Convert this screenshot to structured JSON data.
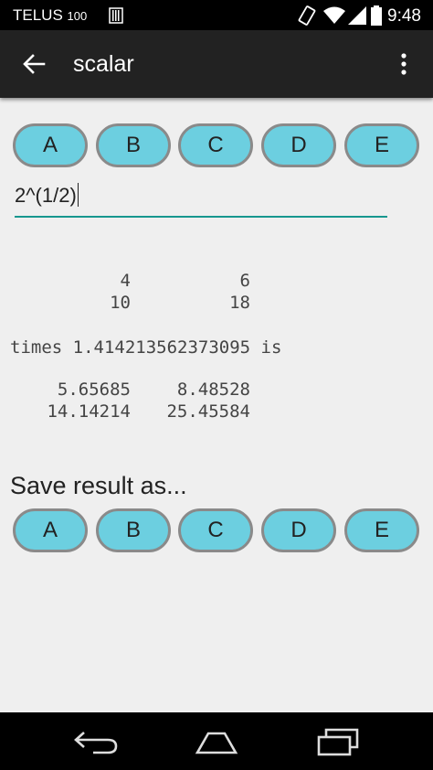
{
  "status_bar": {
    "carrier": "TELUS",
    "carrier_suffix": "100",
    "time": "9:48"
  },
  "app_bar": {
    "title": "scalar"
  },
  "matrix_buttons": [
    "A",
    "B",
    "C",
    "D",
    "E"
  ],
  "expression": {
    "value": "2^(1/2)"
  },
  "input_matrix": {
    "rows": [
      [
        "4",
        "6"
      ],
      [
        "10",
        "18"
      ]
    ]
  },
  "multiplier_text": "times 1.414213562373095 is",
  "result_matrix": {
    "rows": [
      [
        "5.65685",
        "8.48528"
      ],
      [
        "14.14214",
        "25.45584"
      ]
    ]
  },
  "save": {
    "label": "Save result as...",
    "buttons": [
      "A",
      "B",
      "C",
      "D",
      "E"
    ]
  },
  "colors": {
    "button_fill": "#6ccfe0",
    "button_border": "#8a8a8a",
    "underline": "#16978f",
    "app_bar": "#222222"
  }
}
